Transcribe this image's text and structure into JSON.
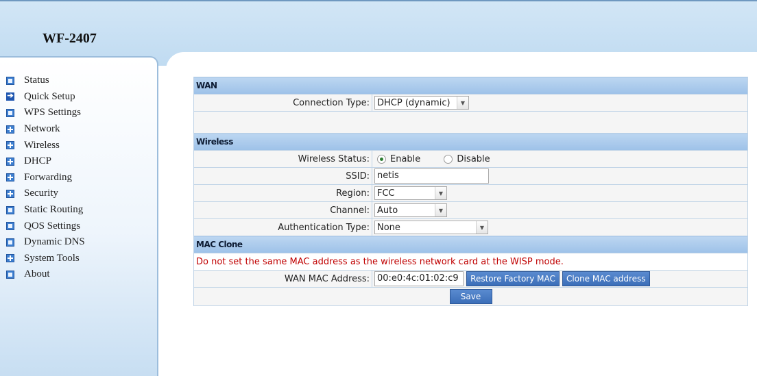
{
  "header": {
    "model": "WF-2407"
  },
  "menu": [
    {
      "label": "Status",
      "icon": "square-icon"
    },
    {
      "label": "Quick Setup",
      "icon": "arrow-icon"
    },
    {
      "label": "WPS Settings",
      "icon": "square-icon"
    },
    {
      "label": "Network",
      "icon": "plus-icon"
    },
    {
      "label": "Wireless",
      "icon": "plus-icon"
    },
    {
      "label": "DHCP",
      "icon": "plus-icon"
    },
    {
      "label": "Forwarding",
      "icon": "plus-icon"
    },
    {
      "label": "Security",
      "icon": "plus-icon"
    },
    {
      "label": "Static Routing",
      "icon": "square-icon"
    },
    {
      "label": "QOS Settings",
      "icon": "square-icon"
    },
    {
      "label": "Dynamic DNS",
      "icon": "square-icon"
    },
    {
      "label": "System Tools",
      "icon": "plus-icon"
    },
    {
      "label": "About",
      "icon": "square-icon"
    }
  ],
  "wan": {
    "section_title": "WAN",
    "connection_type_label": "Connection Type:",
    "connection_type_value": "DHCP (dynamic)"
  },
  "wireless": {
    "section_title": "Wireless",
    "status_label": "Wireless Status:",
    "enable_label": "Enable",
    "disable_label": "Disable",
    "status_selected": "Enable",
    "ssid_label": "SSID:",
    "ssid_value": "netis",
    "region_label": "Region:",
    "region_value": "FCC",
    "channel_label": "Channel:",
    "channel_value": "Auto",
    "auth_label": "Authentication Type:",
    "auth_value": "None"
  },
  "mac_clone": {
    "section_title": "MAC Clone",
    "warning": "Do not set the same MAC address as the wireless network card at the WISP mode.",
    "wan_mac_label": "WAN MAC Address:",
    "wan_mac_value": "00:e0:4c:01:02:c9",
    "restore_button": "Restore Factory MAC",
    "clone_button": "Clone MAC address"
  },
  "save_button": "Save",
  "colors": {
    "header_bg": "#c6dff3",
    "section_header": "#a9c9ec",
    "button": "#4a7cc4",
    "warning_text": "#c00000"
  }
}
